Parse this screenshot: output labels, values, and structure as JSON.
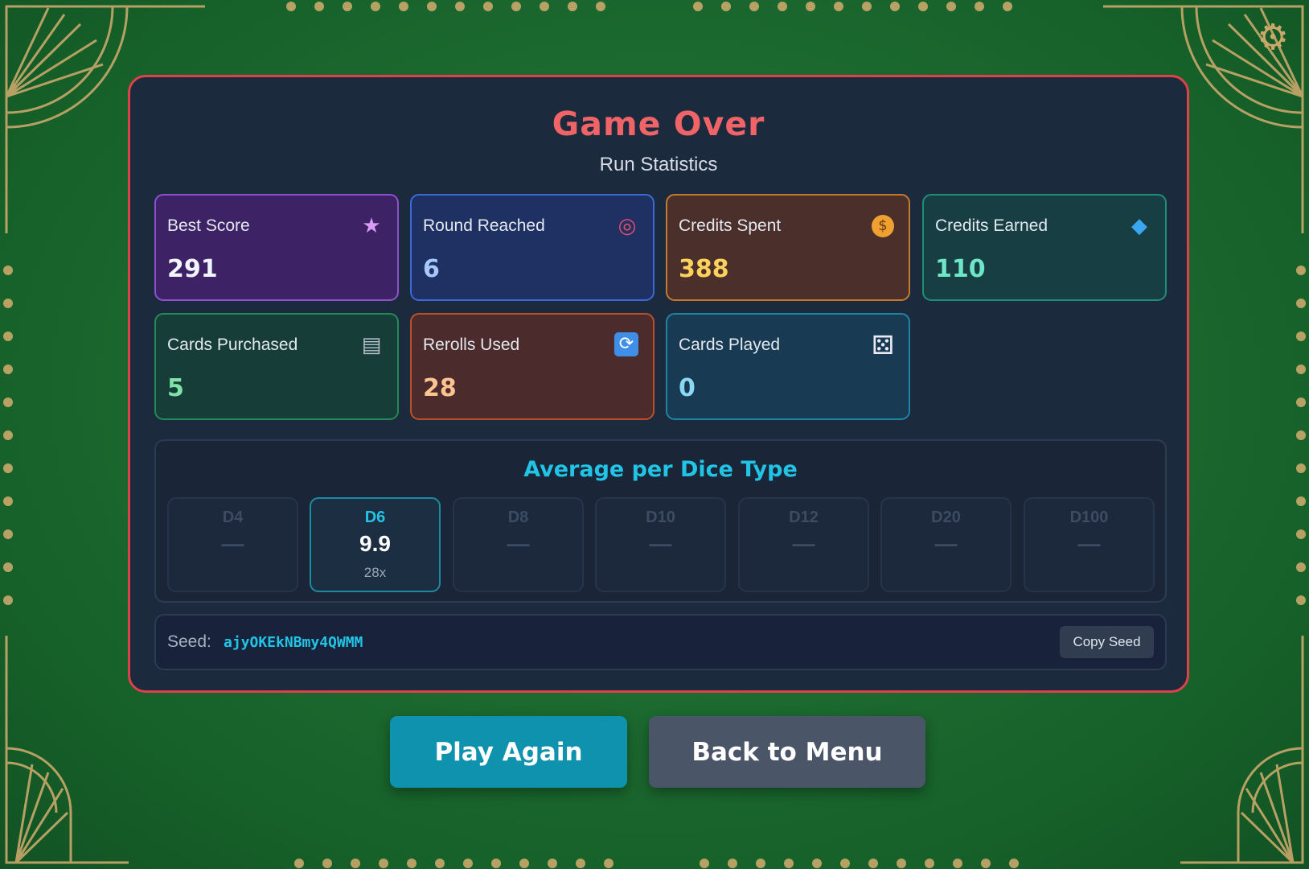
{
  "settings": {
    "icon": "gear-icon",
    "glyph": "⚙"
  },
  "panel": {
    "title": "Game Over",
    "subtitle": "Run Statistics"
  },
  "stats": [
    {
      "label": "Best Score",
      "value": "291",
      "icon": "star-icon",
      "glyph": "★",
      "value_color": "#f2f4ff",
      "icon_color": "#d89cf6"
    },
    {
      "label": "Round Reached",
      "value": "6",
      "icon": "target-icon",
      "glyph": "◎",
      "value_color": "#a9c7ff",
      "icon_color": "#e84a6a"
    },
    {
      "label": "Credits Spent",
      "value": "388",
      "icon": "money-bag-icon",
      "glyph": "$",
      "value_color": "#fcd15c",
      "icon_color": "#f0a030"
    },
    {
      "label": "Credits Earned",
      "value": "110",
      "icon": "gem-icon",
      "glyph": "◆",
      "value_color": "#6ee7c8",
      "icon_color": "#3aa6f0"
    },
    {
      "label": "Cards Purchased",
      "value": "5",
      "icon": "shopping-cart-icon",
      "glyph": "▤",
      "value_color": "#7fe3a7",
      "icon_color": "#b9c2cf"
    },
    {
      "label": "Rerolls Used",
      "value": "28",
      "icon": "reroll-icon",
      "glyph": "⟳",
      "value_color": "#fdc390",
      "icon_color": "#ffffff"
    },
    {
      "label": "Cards Played",
      "value": "0",
      "icon": "dice-icon",
      "glyph": "⚄",
      "value_color": "#8ad8f5",
      "icon_color": "#ecebf3"
    }
  ],
  "dice": {
    "title": "Average per Dice Type",
    "types": [
      {
        "name": "D4",
        "value": "—",
        "count": ""
      },
      {
        "name": "D6",
        "value": "9.9",
        "count": "28x"
      },
      {
        "name": "D8",
        "value": "—",
        "count": ""
      },
      {
        "name": "D10",
        "value": "—",
        "count": ""
      },
      {
        "name": "D12",
        "value": "—",
        "count": ""
      },
      {
        "name": "D20",
        "value": "—",
        "count": ""
      },
      {
        "name": "D100",
        "value": "—",
        "count": ""
      }
    ]
  },
  "seed": {
    "label": "Seed:",
    "value": "ajyOKEkNBmy4QWMM",
    "copy_label": "Copy Seed"
  },
  "actions": {
    "play_again": "Play Again",
    "back_to_menu": "Back to Menu"
  }
}
